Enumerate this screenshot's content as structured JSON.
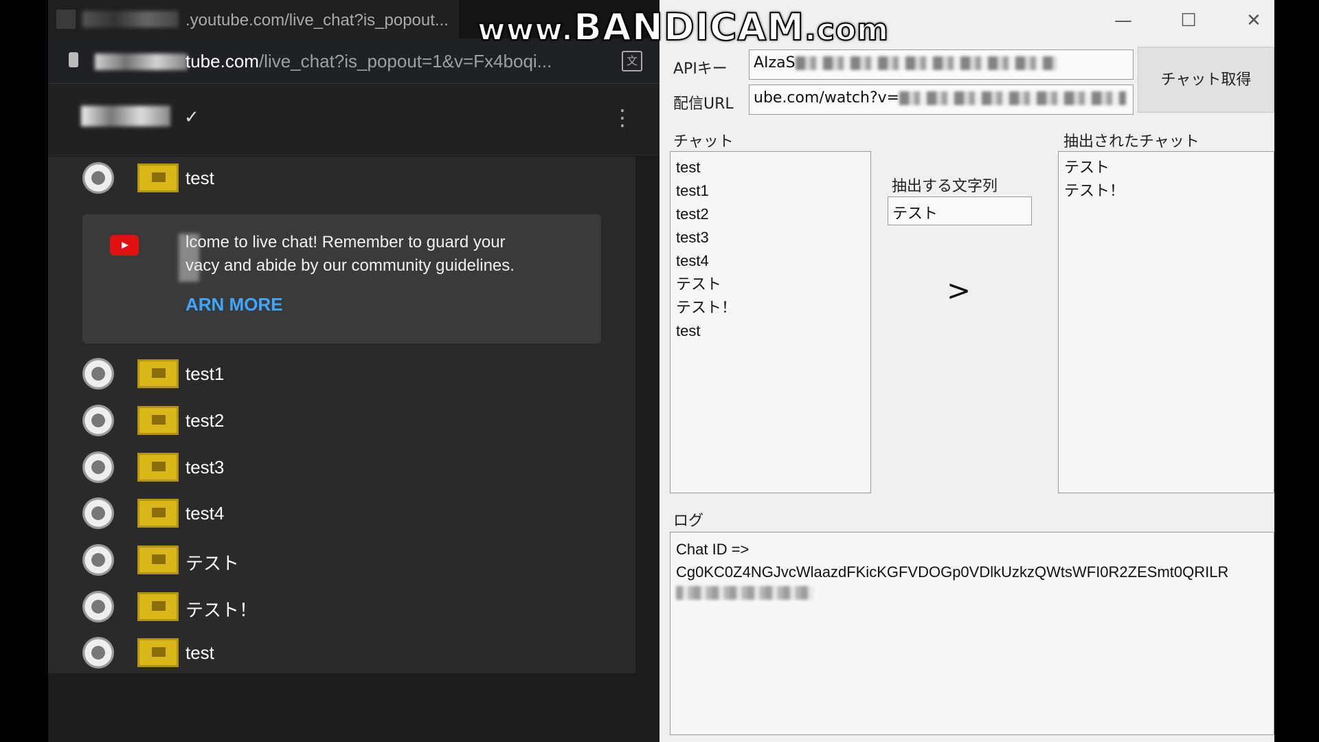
{
  "watermark": {
    "prefix": "www.",
    "brand": "BANDICAM",
    "suffix": ".com"
  },
  "browser": {
    "tab_title": ".youtube.com/live_chat?is_popout...",
    "address": {
      "host": "tube.com",
      "path": "/live_chat?is_popout=1&v=Fx4boqi..."
    },
    "translate_icon": "translate-icon"
  },
  "live_chat": {
    "header_check": "✓",
    "header_menu": "⋮",
    "messages": [
      {
        "text": "test"
      },
      {
        "text": "test1"
      },
      {
        "text": "test2"
      },
      {
        "text": "test3"
      },
      {
        "text": "test4"
      },
      {
        "text": "テスト"
      },
      {
        "text": "テスト！"
      },
      {
        "text": "test"
      }
    ],
    "welcome": {
      "line1": "lcome to live chat! Remember to guard your",
      "line2": "vacy and abide by our community guidelines.",
      "link": "ARN MORE"
    }
  },
  "app": {
    "window_controls": {
      "minimize": "—",
      "maximize": "☐",
      "close": "✕"
    },
    "api_key_label": "APIキー",
    "api_key_value": "AIzaS",
    "stream_url_label": "配信URL",
    "stream_url_value": "ube.com/watch?v=",
    "fetch_button": "チャット取得",
    "chat_label": "チャット",
    "chat_items": [
      "test",
      "test1",
      "test2",
      "test3",
      "test4",
      "テスト",
      "テスト！",
      "test"
    ],
    "extract_label": "抽出する文字列",
    "extract_value": "テスト",
    "arrow": ">",
    "extracted_label": "抽出されたチャット",
    "extracted_items": [
      "テスト",
      "テスト！"
    ],
    "log_label": "ログ",
    "log_lines": [
      "Chat ID =>",
      "Cg0KC0Z4NGJvcWlaazdFKicKGFVDOGp0VDlkUzkzQWtsWFI0R2ZESmt0QRILR"
    ]
  },
  "colors": {
    "yt_link": "#3ea6ff",
    "yt_logo": "#e21010",
    "badge": "#d9b718"
  }
}
